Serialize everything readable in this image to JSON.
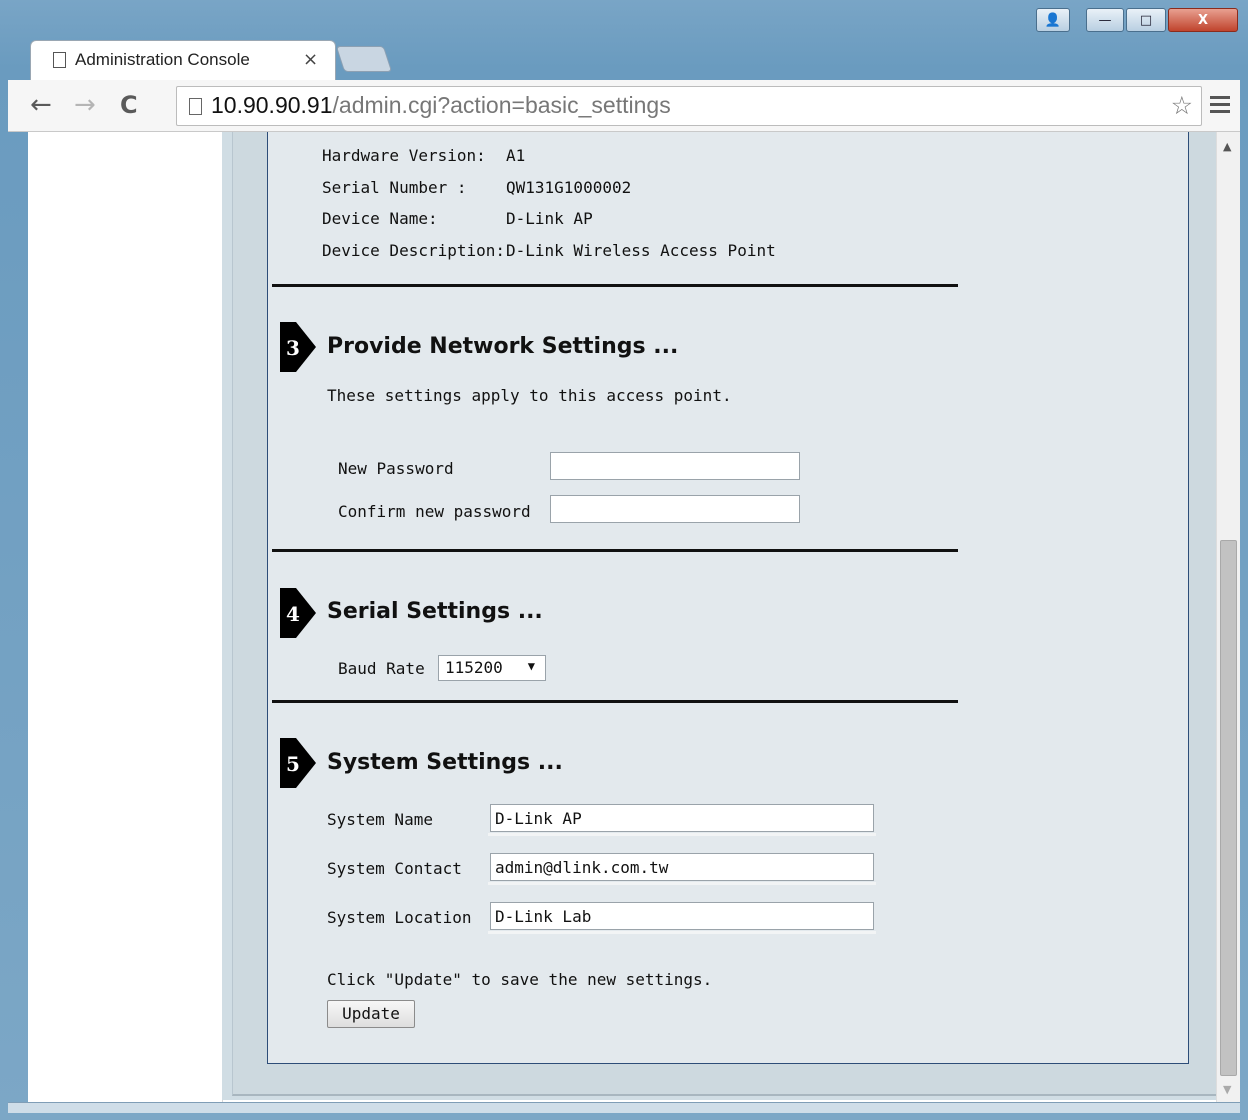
{
  "browser": {
    "tab_title": "Administration Console",
    "tab_close": "×",
    "url_host": "10.90.90.91",
    "url_path": "/admin.cgi?action=basic_settings",
    "icons": [
      "back-arrow-icon",
      "forward-arrow-icon",
      "reload-icon",
      "page-icon",
      "star-icon",
      "menu-icon"
    ]
  },
  "window_controls": {
    "user": "👤",
    "minimize": "—",
    "maximize": "□",
    "close": "X"
  },
  "device_info": [
    {
      "label": "Hardware Version:",
      "value": "A1"
    },
    {
      "label": "Serial Number :",
      "value": "QW131G1000002"
    },
    {
      "label": "Device Name:",
      "value": "D-Link AP"
    },
    {
      "label": "Device Description:",
      "value": "D-Link Wireless Access Point"
    }
  ],
  "network": {
    "step": "3",
    "title": "Provide Network Settings ...",
    "note": "These settings apply to this access point.",
    "new_password_label": "New Password",
    "confirm_password_label": "Confirm new password",
    "new_password_value": "",
    "confirm_password_value": ""
  },
  "serial": {
    "step": "4",
    "title": "Serial Settings ...",
    "baud_label": "Baud Rate",
    "baud_value": "115200"
  },
  "system": {
    "step": "5",
    "title": "System Settings ...",
    "name_label": "System Name",
    "name_value": "D-Link AP",
    "contact_label": "System Contact",
    "contact_value": "admin@dlink.com.tw",
    "location_label": "System Location",
    "location_value": "D-Link Lab",
    "update_note": "Click \"Update\" to save the new settings.",
    "update_button": "Update"
  },
  "scrollbar": {
    "position_fraction": 0.56
  }
}
